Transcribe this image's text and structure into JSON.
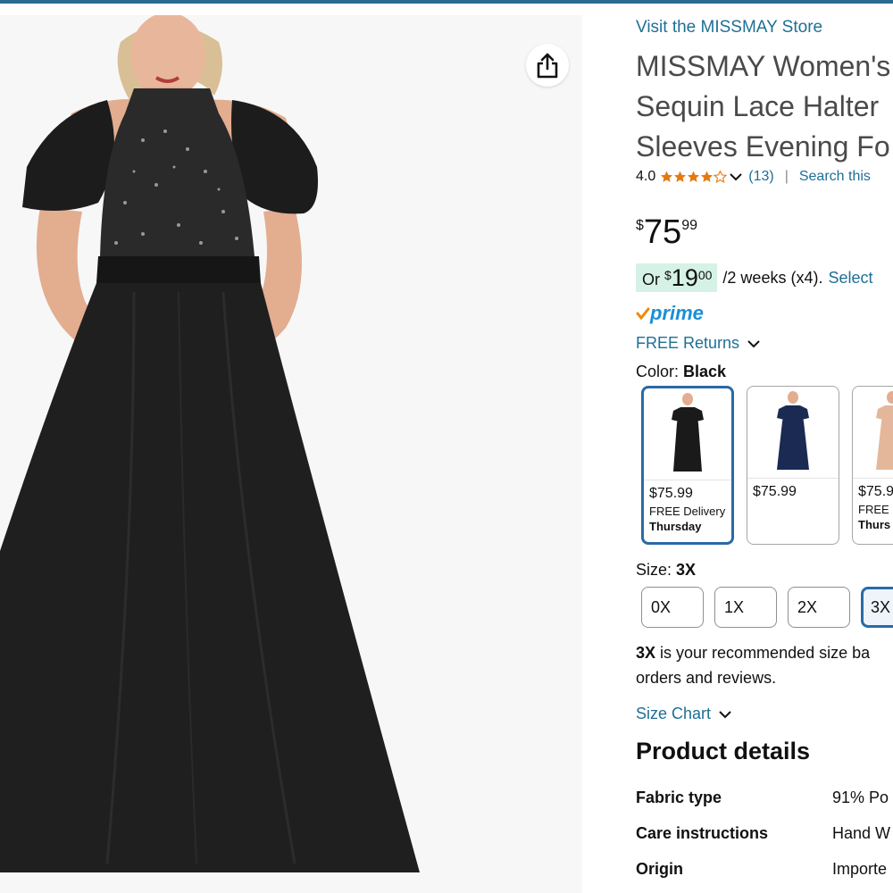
{
  "store_link": "Visit the MISSMAY Store",
  "title_lines": [
    "MISSMAY Women's",
    "Sequin Lace Halter",
    "Sleeves Evening Fo"
  ],
  "rating": {
    "value": "4.0",
    "stars": 4,
    "count": "(13)",
    "separator": "|",
    "search_link": "Search this"
  },
  "price": {
    "symbol": "$",
    "whole": "75",
    "fraction": "99"
  },
  "installment": {
    "prefix": "Or",
    "symbol": "$",
    "whole": "19",
    "fraction": "00",
    "suffix": "/2 weeks (x4).",
    "link": "Select"
  },
  "prime": {
    "label": "prime"
  },
  "free_returns": "FREE Returns",
  "color": {
    "label": "Color:",
    "value": "Black"
  },
  "swatches": [
    {
      "price": "$75.99",
      "delivery": "FREE Delivery",
      "day": "Thursday",
      "dress_color": "#1a1a1a",
      "selected": true
    },
    {
      "price": "$75.99",
      "delivery": "",
      "day": "",
      "dress_color": "#1b2a52",
      "selected": false
    },
    {
      "price": "$75.9",
      "delivery": "FREE D",
      "day": "Thurs",
      "dress_color": "#e4b79a",
      "selected": false
    }
  ],
  "size": {
    "label": "Size:",
    "value": "3X",
    "options": [
      "0X",
      "1X",
      "2X",
      "3X"
    ]
  },
  "recommendation": {
    "size": "3X",
    "text_line1": " is your recommended size ba",
    "text_line2": "orders and reviews."
  },
  "size_chart": "Size Chart",
  "product_details": {
    "heading": "Product details",
    "rows": [
      {
        "key": "Fabric type",
        "value": "91% Po"
      },
      {
        "key": "Care instructions",
        "value": "Hand W"
      },
      {
        "key": "Origin",
        "value": "Importe"
      }
    ]
  },
  "colors": {
    "link": "#1f6f95",
    "star": "#e47911",
    "prime_blue": "#1a8fd7",
    "prime_check": "#f08804",
    "installment_bg": "#d6f2e6",
    "selected_border": "#2a6aa8"
  },
  "icons": [
    "share-icon",
    "star-icon",
    "chevron-down-icon",
    "prime-check-icon"
  ]
}
